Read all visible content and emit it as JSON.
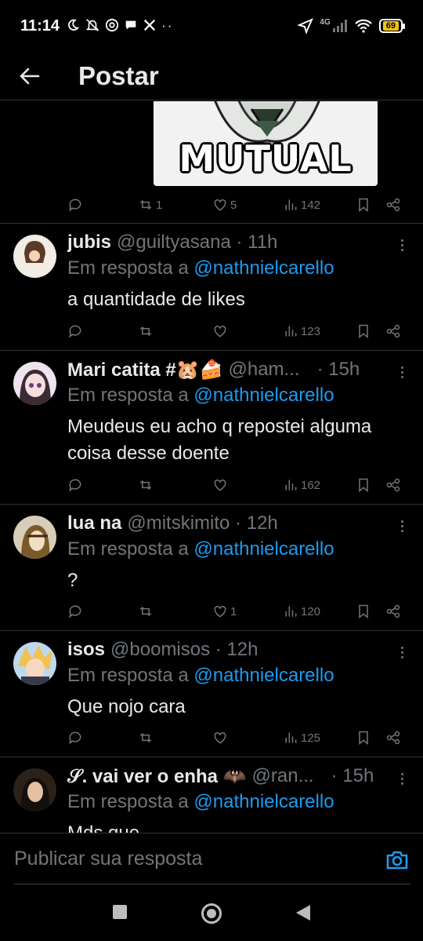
{
  "status_bar": {
    "time": "11:14",
    "left_icons": [
      "moon-icon",
      "notifications-off-icon",
      "threads-icon",
      "chat-icon",
      "x-icon",
      "more-dots"
    ],
    "network": "4G",
    "battery": "69"
  },
  "header": {
    "title": "Postar"
  },
  "original_post": {
    "image_caption": "MUTUAL",
    "actions": {
      "replies": "",
      "reposts": "1",
      "likes": "5",
      "views": "142"
    }
  },
  "replies": [
    {
      "name": "jubis",
      "handle": "@guiltyasana · 11h",
      "reply_prefix": "Em resposta a",
      "mention": "@nathnielcarello",
      "text": "a quantidade de likes",
      "actions": {
        "replies": "",
        "reposts": "",
        "likes": "",
        "views": "123"
      }
    },
    {
      "name": "Mari catita #🐹🍰",
      "handle": "@ham...",
      "time": "· 15h",
      "reply_prefix": "Em resposta a",
      "mention": "@nathnielcarello",
      "text": "Meudeus eu acho q repostei alguma coisa desse doente",
      "actions": {
        "replies": "",
        "reposts": "",
        "likes": "",
        "views": "162"
      }
    },
    {
      "name": "lua na",
      "handle": "@mitskimito · 12h",
      "reply_prefix": "Em resposta a",
      "mention": "@nathnielcarello",
      "text": "?",
      "actions": {
        "replies": "",
        "reposts": "",
        "likes": "1",
        "views": "120"
      }
    },
    {
      "name": "isos",
      "handle": "@boomisos · 12h",
      "reply_prefix": "Em resposta a",
      "mention": "@nathnielcarello",
      "text": "Que nojo cara",
      "actions": {
        "replies": "",
        "reposts": "",
        "likes": "",
        "views": "125"
      }
    },
    {
      "name": "𝒮. vai ver o enha 🦇",
      "handle": "@ran...",
      "time": "· 15h",
      "reply_prefix": "Em resposta a",
      "mention": "@nathnielcarello",
      "text": "Mds que"
    }
  ],
  "composer": {
    "placeholder": "Publicar sua resposta"
  },
  "colors": {
    "background": "#000000",
    "text": "#e7e9ea",
    "muted": "#71767b",
    "link": "#1d9bf0",
    "divider": "#2f3336"
  }
}
